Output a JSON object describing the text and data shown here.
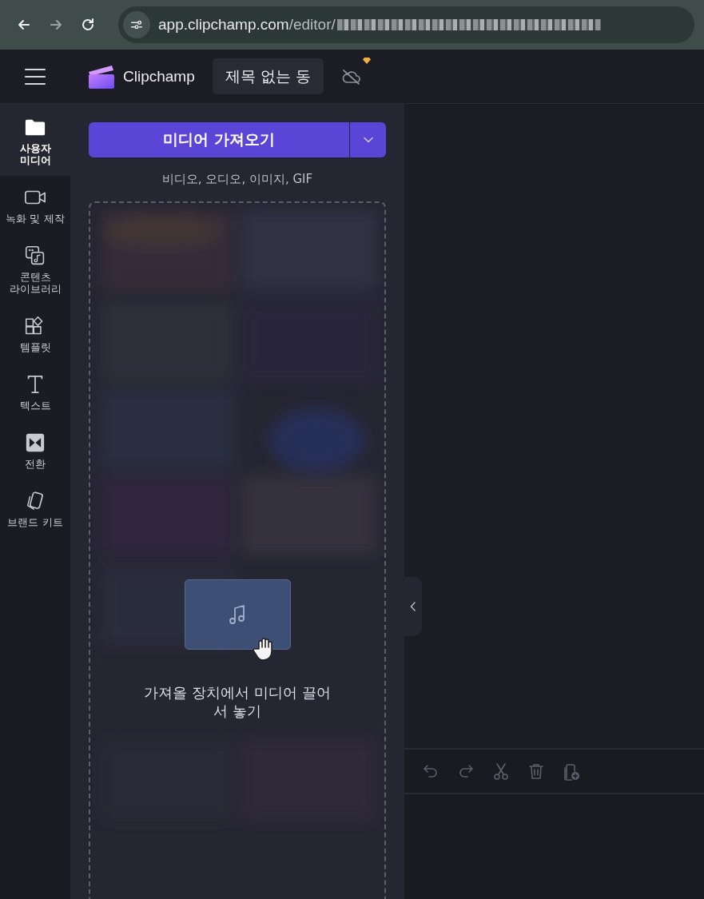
{
  "browser": {
    "url_host": "app.clipchamp.com",
    "url_path": "/editor/"
  },
  "header": {
    "brand": "Clipchamp",
    "project_title": "제목 없는 동"
  },
  "sidebar": {
    "items": [
      {
        "kind": "folder",
        "label": "사용자 미디어",
        "selected": true
      },
      {
        "kind": "camera",
        "label": "녹화 및 제작",
        "selected": false
      },
      {
        "kind": "library",
        "label": "콘텐츠 라이브러리",
        "selected": false
      },
      {
        "kind": "templates",
        "label": "템플릿",
        "selected": false
      },
      {
        "kind": "text",
        "label": "텍스트",
        "selected": false
      },
      {
        "kind": "transition",
        "label": "전환",
        "selected": false
      },
      {
        "kind": "brand",
        "label": "브랜드 키트",
        "selected": false
      }
    ]
  },
  "media_panel": {
    "import_button": "미디어 가져오기",
    "formats": "비디오, 오디오, 이미지, GIF",
    "drop_hint": "가져올 장치에서 미디어 끌어서 놓기"
  },
  "timeline_toolbar": [
    {
      "kind": "undo",
      "disabled": true
    },
    {
      "kind": "redo",
      "disabled": true
    },
    {
      "kind": "cut",
      "disabled": true
    },
    {
      "kind": "delete",
      "disabled": true
    },
    {
      "kind": "add-copy",
      "disabled": true
    }
  ]
}
